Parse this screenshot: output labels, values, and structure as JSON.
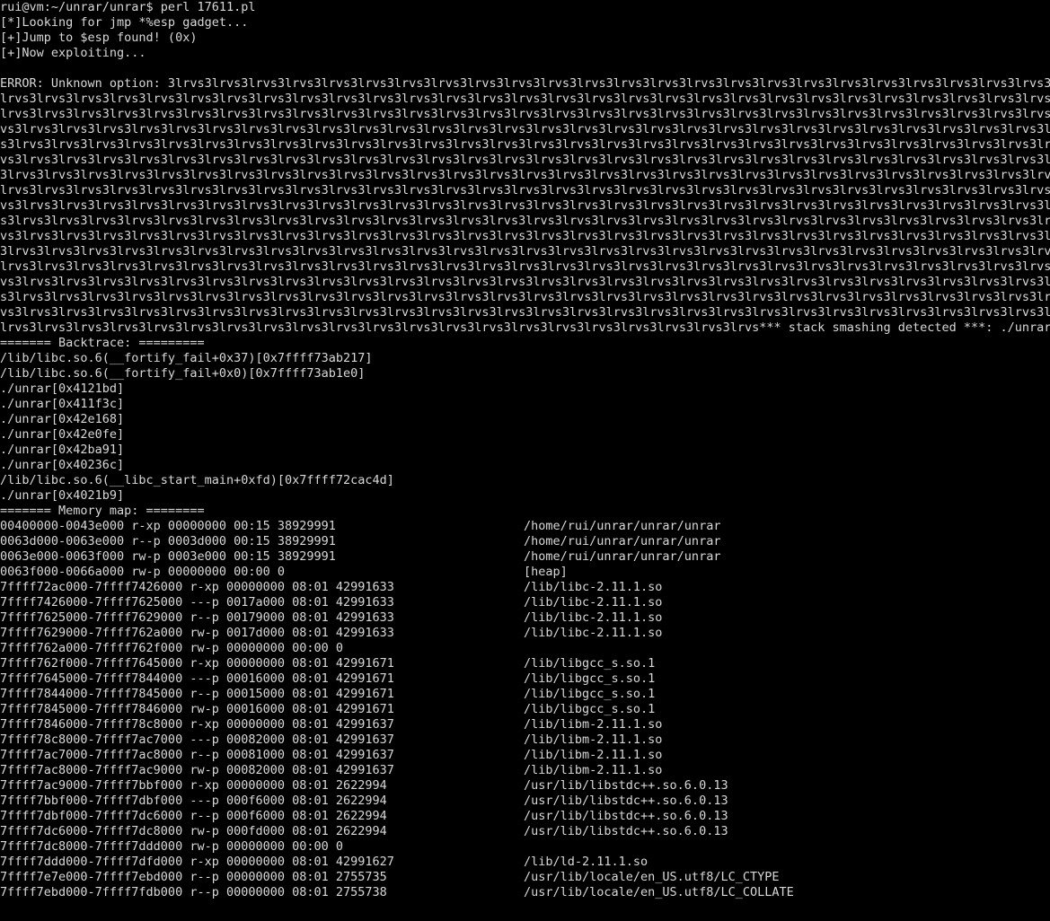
{
  "colors": {
    "background": "#000000",
    "foreground": "#d8d8d8"
  },
  "prompt": {
    "text": "rui@vm:~/unrar/unrar$ perl 17611.pl"
  },
  "output": {
    "lines": [
      "[*]Looking for jmp *%esp gadget...",
      "[+]Jump to $esp found! (0x)",
      "[+]Now exploiting...",
      "",
      "ERROR: Unknown option: 3lrvs3lrvs3lrvs3lrvs3lrvs3lrvs3lrvs3lrvs3lrvs3lrvs3lrvs3lrvs3lrvs3lrvs3lrvs3lrvs3lrvs3lrvs3lrvs3lrvs3lrvs3lrvs3lrvs3lrvs3lrvs3lrvs3lrvs3lrvs3lrvs3lrvs3",
      "lrvs3lrvs3lrvs3lrvs3lrvs3lrvs3lrvs3lrvs3lrvs3lrvs3lrvs3lrvs3lrvs3lrvs3lrvs3lrvs3lrvs3lrvs3lrvs3lrvs3lrvs3lrvs3lrvs3lrvs3lrvs3lrvs3lrvs3lrvs3lrvs3lrvs3lrvs3lrvs3lrvs3lrvs3lr",
      "lrvs3lrvs3lrvs3lrvs3lrvs3lrvs3lrvs3lrvs3lrvs3lrvs3lrvs3lrvs3lrvs3lrvs3lrvs3lrvs3lrvs3lrvs3lrvs3lrvs3lrvs3lrvs3lrvs3lrvs3lrvs3lrvs3lrvs3lrvs3lrvs3lrvs3lrvs3lrvs3lrvs3l",
      "vs3lrvs3lrvs3lrvs3lrvs3lrvs3lrvs3lrvs3lrvs3lrvs3lrvs3lrvs3lrvs3lrvs3lrvs3lrvs3lrvs3lrvs3lrvs3lrvs3lrvs3lrvs3lrvs3lrvs3lrvs3lrvs3lrvs3lrvs3lrvs3lrvs3lrvs3lrvs3lrvs3lrvs",
      "s3lrvs3lrvs3lrvs3lrvs3lrvs3lrvs3lrvs3lrvs3lrvs3lrvs3lrvs3lrvs3lrvs3lrvs3lrvs3lrvs3lrvs3lrvs3lrvs3lrvs3lrvs3lrvs3lrvs3lrvs3lrvs3lrvs3lrvs3lrvs3lrvs3lrvs3lrvs3lrvs3lrvs3",
      "vs3lrvs3lrvs3lrvs3lrvs3lrvs3lrvs3lrvs3lrvs3lrvs3lrvs3lrvs3lrvs3lrvs3lrvs3lrvs3lrvs3lrvs3lrvs3lrvs3lrvs3lrvs3lrvs3lrvs3lrvs3lrvs3lrvs3lrvs3lrvs3lrvs3lrvs3lrvs3lrvs3lrvs3lr",
      "3lrvs3lrvs3lrvs3lrvs3lrvs3lrvs3lrvs3lrvs3lrvs3lrvs3lrvs3lrvs3lrvs3lrvs3lrvs3lrvs3lrvs3lrvs3lrvs3lrvs3lrvs3lrvs3lrvs3lrvs3lrvs3lrvs3lrvs3lrvs3lrvs3lrvs3lrvs3lrvs3lrvs3lrvs",
      "lrvs3lrvs3lrvs3lrvs3lrvs3lrvs3lrvs3lrvs3lrvs3lrvs3lrvs3lrvs3lrvs3lrvs3lrvs3lrvs3lrvs3lrvs3lrvs3lrvs3lrvs3lrvs3lrvs3lrvs3lrvs3lrvs3lrvs3lrvs3lrvs3lrvs3lrvs3lrvs3lrvs3l",
      "vs3lrvs3lrvs3lrvs3lrvs3lrvs3lrvs3lrvs3lrvs3lrvs3lrvs3lrvs3lrvs3lrvs3lrvs3lrvs3lrvs3lrvs3lrvs3lrvs3lrvs3lrvs3lrvs3lrvs3lrvs3lrvs3lrvs3lrvs3lrvs3lrvs3lrvs3lrvs3lrvs3lrvs",
      "s3lrvs3lrvs3lrvs3lrvs3lrvs3lrvs3lrvs3lrvs3lrvs3lrvs3lrvs3lrvs3lrvs3lrvs3lrvs3lrvs3lrvs3lrvs3lrvs3lrvs3lrvs3lrvs3lrvs3lrvs3lrvs3lrvs3lrvs3lrvs3lrvs3lrvs3lrvs3lrvs3lrvs3",
      "vs3lrvs3lrvs3lrvs3lrvs3lrvs3lrvs3lrvs3lrvs3lrvs3lrvs3lrvs3lrvs3lrvs3lrvs3lrvs3lrvs3lrvs3lrvs3lrvs3lrvs3lrvs3lrvs3lrvs3lrvs3lrvs3lrvs3lrvs3lrvs3lrvs3lrvs3lrvs3lrvs3lrvs3lr",
      "3lrvs3lrvs3lrvs3lrvs3lrvs3lrvs3lrvs3lrvs3lrvs3lrvs3lrvs3lrvs3lrvs3lrvs3lrvs3lrvs3lrvs3lrvs3lrvs3lrvs3lrvs3lrvs3lrvs3lrvs3lrvs3lrvs3lrvs3lrvs3lrvs3lrvs3lrvs3lrvs3lrvs",
      "lrvs3lrvs3lrvs3lrvs3lrvs3lrvs3lrvs3lrvs3lrvs3lrvs3lrvs3lrvs3lrvs3lrvs3lrvs3lrvs3lrvs3lrvs3lrvs3lrvs3lrvs3lrvs3lrvs3lrvs3lrvs3lrvs3lrvs3lrvs3lrvs3lrvs3lrvs3lrvs3lrvs3l",
      "vs3lrvs3lrvs3lrvs3lrvs3lrvs3lrvs3lrvs3lrvs3lrvs3lrvs3lrvs3lrvs3lrvs3lrvs3lrvs3lrvs3lrvs3lrvs3lrvs3lrvs3lrvs3lrvs3lrvs3lrvs3lrvs3lrvs3lrvs3lrvs3lrvs3lrvs3lrvs3lrvs3lrvs",
      "s3lrvs3lrvs3lrvs3lrvs3lrvs3lrvs3lrvs3lrvs3lrvs3lrvs3lrvs3lrvs3lrvs3lrvs3lrvs3lrvs3lrvs3lrvs3lrvs3lrvs3lrvs3lrvs3lrvs3lrvs3lrvs3lrvs3lrvs3lrvs3lrvs3lrvs3lrvs3lrvs3lrvs3",
      "vs3lrvs3lrvs3lrvs3lrvs3lrvs3lrvs3lrvs3lrvs3lrvs3lrvs3lrvs3lrvs3lrvs3lrvs3lrvs3lrvs3lrvs3lrvs3lrvs3lrvs3lrvs3lrvs3lrvs3lrvs3lrvs3lrvs3lrvs3lrvs3lrvs3lrvs3lrvs3lrvs3lrvs3lr",
      "lrvs3lrvs3lrvs3lrvs3lrvs3lrvs3lrvs3lrvs3lrvs3lrvs3lrvs3lrvs3lrvs3lrvs3lrvs3lrvs3lrvs3lrvs3lrvs3lrvs3lrvs*** stack smashing detected ***: ./unrar terminated",
      "======= Backtrace: =========",
      "/lib/libc.so.6(__fortify_fail+0x37)[0x7ffff73ab217]",
      "/lib/libc.so.6(__fortify_fail+0x0)[0x7ffff73ab1e0]",
      "./unrar[0x4121bd]",
      "./unrar[0x411f3c]",
      "./unrar[0x42e168]",
      "./unrar[0x42e0fe]",
      "./unrar[0x42ba91]",
      "./unrar[0x40236c]",
      "/lib/libc.so.6(__libc_start_main+0xfd)[0x7ffff72cac4d]",
      "./unrar[0x4021b9]",
      "======= Memory map: ========"
    ],
    "memory_map": [
      {
        "left": "00400000-0043e000 r-xp 00000000 00:15 38929991",
        "path": "/home/rui/unrar/unrar/unrar"
      },
      {
        "left": "0063d000-0063e000 r--p 0003d000 00:15 38929991",
        "path": "/home/rui/unrar/unrar/unrar"
      },
      {
        "left": "0063e000-0063f000 rw-p 0003e000 00:15 38929991",
        "path": "/home/rui/unrar/unrar/unrar"
      },
      {
        "left": "0063f000-0066a000 rw-p 00000000 00:00 0",
        "path": "[heap]"
      },
      {
        "left": "7ffff72ac000-7ffff7426000 r-xp 00000000 08:01 42991633",
        "path": "/lib/libc-2.11.1.so"
      },
      {
        "left": "7ffff7426000-7ffff7625000 ---p 0017a000 08:01 42991633",
        "path": "/lib/libc-2.11.1.so"
      },
      {
        "left": "7ffff7625000-7ffff7629000 r--p 00179000 08:01 42991633",
        "path": "/lib/libc-2.11.1.so"
      },
      {
        "left": "7ffff7629000-7ffff762a000 rw-p 0017d000 08:01 42991633",
        "path": "/lib/libc-2.11.1.so"
      },
      {
        "left": "7ffff762a000-7ffff762f000 rw-p 00000000 00:00 0",
        "path": ""
      },
      {
        "left": "7ffff762f000-7ffff7645000 r-xp 00000000 08:01 42991671",
        "path": "/lib/libgcc_s.so.1"
      },
      {
        "left": "7ffff7645000-7ffff7844000 ---p 00016000 08:01 42991671",
        "path": "/lib/libgcc_s.so.1"
      },
      {
        "left": "7ffff7844000-7ffff7845000 r--p 00015000 08:01 42991671",
        "path": "/lib/libgcc_s.so.1"
      },
      {
        "left": "7ffff7845000-7ffff7846000 rw-p 00016000 08:01 42991671",
        "path": "/lib/libgcc_s.so.1"
      },
      {
        "left": "7ffff7846000-7ffff78c8000 r-xp 00000000 08:01 42991637",
        "path": "/lib/libm-2.11.1.so"
      },
      {
        "left": "7ffff78c8000-7ffff7ac7000 ---p 00082000 08:01 42991637",
        "path": "/lib/libm-2.11.1.so"
      },
      {
        "left": "7ffff7ac7000-7ffff7ac8000 r--p 00081000 08:01 42991637",
        "path": "/lib/libm-2.11.1.so"
      },
      {
        "left": "7ffff7ac8000-7ffff7ac9000 rw-p 00082000 08:01 42991637",
        "path": "/lib/libm-2.11.1.so"
      },
      {
        "left": "7ffff7ac9000-7ffff7bbf000 r-xp 00000000 08:01 2622994",
        "path": "/usr/lib/libstdc++.so.6.0.13"
      },
      {
        "left": "7ffff7bbf000-7ffff7dbf000 ---p 000f6000 08:01 2622994",
        "path": "/usr/lib/libstdc++.so.6.0.13"
      },
      {
        "left": "7ffff7dbf000-7ffff7dc6000 r--p 000f6000 08:01 2622994",
        "path": "/usr/lib/libstdc++.so.6.0.13"
      },
      {
        "left": "7ffff7dc6000-7ffff7dc8000 rw-p 000fd000 08:01 2622994",
        "path": "/usr/lib/libstdc++.so.6.0.13"
      },
      {
        "left": "7ffff7dc8000-7ffff7ddd000 rw-p 00000000 00:00 0",
        "path": ""
      },
      {
        "left": "7ffff7ddd000-7ffff7dfd000 r-xp 00000000 08:01 42991627",
        "path": "/lib/ld-2.11.1.so"
      },
      {
        "left": "7ffff7e7e000-7ffff7ebd000 r--p 00000000 08:01 2755735",
        "path": "/usr/lib/locale/en_US.utf8/LC_CTYPE"
      },
      {
        "left": "7ffff7ebd000-7ffff7fdb000 r--p 00000000 08:01 2755738",
        "path": "/usr/lib/locale/en_US.utf8/LC_COLLATE"
      }
    ]
  }
}
